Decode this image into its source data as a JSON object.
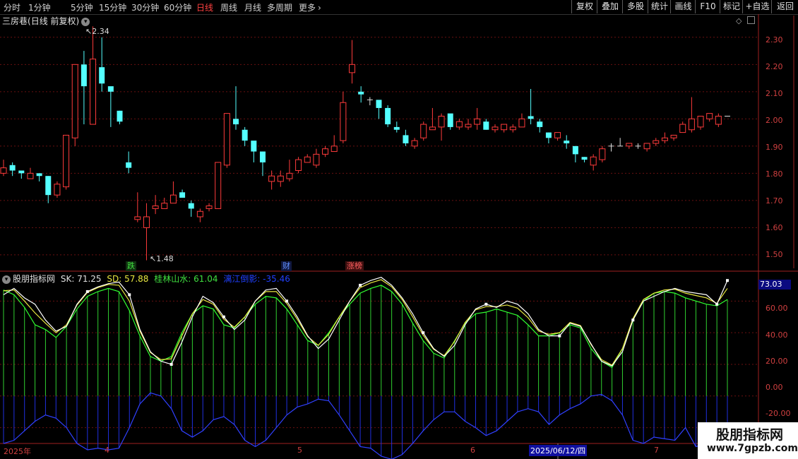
{
  "toolbar": {
    "periods": [
      "分时",
      "1分钟",
      "5分钟",
      "15分钟",
      "30分钟",
      "60分钟",
      "日线",
      "周线",
      "月线",
      "多周期",
      "更多"
    ],
    "active_period": "日线",
    "more_arrow": "›",
    "buttons": [
      "复权",
      "叠加",
      "多股",
      "统计",
      "画线",
      "F10",
      "标记",
      "+自选",
      "返回"
    ]
  },
  "main_chart": {
    "stock_name": "三房巷",
    "mode": "(日线 前复权)",
    "high_marker": "2.34",
    "low_marker": "1.48",
    "price_ticks": [
      "2.30",
      "2.20",
      "2.10",
      "2.00",
      "1.90",
      "1.80",
      "1.70",
      "1.60",
      "1.50"
    ],
    "event_tags": [
      {
        "label": "跌",
        "color": "#40c040"
      },
      {
        "label": "财",
        "color": "#4080ff"
      },
      {
        "label": "涨榜",
        "color": "#ff5050"
      }
    ],
    "up_color": "#ff3b3b",
    "down_color": "#54ffff"
  },
  "indicator": {
    "name": "股朋指标网",
    "sk_label": "SK: 71.25",
    "sd_label": "SD: 57.88",
    "gl_label": "桂林山水: 61.04",
    "lj_label": "漓江倒影: -35.46",
    "current_value": "73.03",
    "ticks": [
      "60.00",
      "40.00",
      "20.00",
      "0.00",
      "-20.00"
    ]
  },
  "date_axis": {
    "labels": [
      "2025年",
      "4",
      "5",
      "6",
      "2025/06/12/四",
      "7"
    ]
  },
  "watermark": {
    "title": "股朋指标网",
    "url": "www.7gpzb.com"
  },
  "chart_data": {
    "type": "candlestick",
    "columns": [
      "open",
      "high",
      "low",
      "close"
    ],
    "candles": [
      [
        1.8,
        1.85,
        1.79,
        1.82
      ],
      [
        1.83,
        1.84,
        1.79,
        1.81
      ],
      [
        1.81,
        1.81,
        1.78,
        1.8
      ],
      [
        1.78,
        1.82,
        1.78,
        1.8
      ],
      [
        1.8,
        1.8,
        1.77,
        1.79
      ],
      [
        1.79,
        1.79,
        1.69,
        1.72
      ],
      [
        1.72,
        1.77,
        1.71,
        1.76
      ],
      [
        1.75,
        1.94,
        1.74,
        1.94
      ],
      [
        1.93,
        2.19,
        1.9,
        2.2
      ],
      [
        2.2,
        2.25,
        1.98,
        2.12
      ],
      [
        1.98,
        2.34,
        1.98,
        2.22
      ],
      [
        2.19,
        2.3,
        2.1,
        2.13
      ],
      [
        2.12,
        2.11,
        1.97,
        2.1
      ],
      [
        2.03,
        2.03,
        1.98,
        1.99
      ],
      [
        1.84,
        1.88,
        1.8,
        1.82
      ],
      [
        1.63,
        1.73,
        1.62,
        1.64
      ],
      [
        1.6,
        1.69,
        1.48,
        1.64
      ],
      [
        1.67,
        1.72,
        1.65,
        1.68
      ],
      [
        1.67,
        1.71,
        1.67,
        1.69
      ],
      [
        1.69,
        1.77,
        1.69,
        1.72
      ],
      [
        1.73,
        1.74,
        1.71,
        1.71
      ],
      [
        1.69,
        1.7,
        1.64,
        1.67
      ],
      [
        1.64,
        1.67,
        1.62,
        1.66
      ],
      [
        1.67,
        1.69,
        1.66,
        1.68
      ],
      [
        1.67,
        1.72,
        1.67,
        1.84
      ],
      [
        1.83,
        2.02,
        1.82,
        2.02
      ],
      [
        2.0,
        2.12,
        1.96,
        1.98
      ],
      [
        1.96,
        1.97,
        1.9,
        1.92
      ],
      [
        1.92,
        1.89,
        1.84,
        1.88
      ],
      [
        1.88,
        1.88,
        1.79,
        1.84
      ],
      [
        1.77,
        1.81,
        1.74,
        1.79
      ],
      [
        1.77,
        1.81,
        1.75,
        1.79
      ],
      [
        1.78,
        1.85,
        1.77,
        1.8
      ],
      [
        1.81,
        1.86,
        1.8,
        1.85
      ],
      [
        1.84,
        1.87,
        1.84,
        1.86
      ],
      [
        1.83,
        1.89,
        1.82,
        1.87
      ],
      [
        1.87,
        1.9,
        1.86,
        1.89
      ],
      [
        1.88,
        1.94,
        1.88,
        1.9
      ],
      [
        1.92,
        2.1,
        1.91,
        2.06
      ],
      [
        2.17,
        2.29,
        2.13,
        2.2
      ],
      [
        2.1,
        2.12,
        2.06,
        2.09
      ],
      [
        2.07,
        2.08,
        2.05,
        2.07
      ],
      [
        2.07,
        2.04,
        2.0,
        2.04
      ],
      [
        2.04,
        2.05,
        1.97,
        1.98
      ],
      [
        1.97,
        1.99,
        1.95,
        1.96
      ],
      [
        1.94,
        1.96,
        1.9,
        1.91
      ],
      [
        1.9,
        1.93,
        1.89,
        1.92
      ],
      [
        1.93,
        1.99,
        1.92,
        1.98
      ],
      [
        1.96,
        2.04,
        1.96,
        1.97
      ],
      [
        1.97,
        2.02,
        1.92,
        2.01
      ],
      [
        2.02,
        2.01,
        1.96,
        1.97
      ],
      [
        1.97,
        2.0,
        1.96,
        1.99
      ],
      [
        1.97,
        2.0,
        1.96,
        1.98
      ],
      [
        1.98,
        2.04,
        1.96,
        2.0
      ],
      [
        1.99,
        2.0,
        1.96,
        1.96
      ],
      [
        1.96,
        1.98,
        1.95,
        1.97
      ],
      [
        1.96,
        1.98,
        1.95,
        1.98
      ],
      [
        1.96,
        1.98,
        1.95,
        1.97
      ],
      [
        1.97,
        2.02,
        1.97,
        2.0
      ],
      [
        2.01,
        2.11,
        1.98,
        2.0
      ],
      [
        1.99,
        2.0,
        1.95,
        1.97
      ],
      [
        1.95,
        1.95,
        1.91,
        1.93
      ],
      [
        1.93,
        1.95,
        1.92,
        1.95
      ],
      [
        1.92,
        1.94,
        1.89,
        1.91
      ],
      [
        1.9,
        1.9,
        1.84,
        1.87
      ],
      [
        1.86,
        1.86,
        1.84,
        1.85
      ],
      [
        1.83,
        1.87,
        1.81,
        1.86
      ],
      [
        1.85,
        1.9,
        1.84,
        1.89
      ],
      [
        1.9,
        1.91,
        1.88,
        1.9
      ],
      [
        1.9,
        1.93,
        1.9,
        1.9
      ],
      [
        1.9,
        1.91,
        1.89,
        1.91
      ],
      [
        1.9,
        1.91,
        1.89,
        1.9
      ],
      [
        1.89,
        1.91,
        1.88,
        1.91
      ],
      [
        1.91,
        1.93,
        1.9,
        1.92
      ],
      [
        1.92,
        1.95,
        1.91,
        1.93
      ],
      [
        1.93,
        1.94,
        1.92,
        1.94
      ],
      [
        1.95,
        1.99,
        1.95,
        1.98
      ],
      [
        1.96,
        2.08,
        1.95,
        2.0
      ],
      [
        1.97,
        2.01,
        1.96,
        2.01
      ],
      [
        2.0,
        2.02,
        1.99,
        2.02
      ],
      [
        1.98,
        2.02,
        1.97,
        2.01
      ],
      [
        2.01,
        2.01,
        2.01,
        2.01
      ]
    ],
    "indicator_series": {
      "sk": [
        64,
        68,
        62,
        58,
        48,
        41,
        44,
        58,
        66,
        69,
        71,
        72,
        64,
        42,
        28,
        22,
        20,
        34,
        50,
        63,
        59,
        50,
        42,
        48,
        60,
        67,
        68,
        60,
        50,
        38,
        30,
        36,
        48,
        60,
        70,
        73,
        75,
        70,
        62,
        52,
        40,
        30,
        25,
        32,
        45,
        55,
        58,
        56,
        60,
        58,
        52,
        42,
        38,
        38,
        46,
        44,
        33,
        22,
        19,
        28,
        48,
        60,
        63,
        66,
        68,
        66,
        65,
        64,
        58,
        73
      ],
      "sd": [
        67,
        64,
        56,
        45,
        42,
        37,
        44,
        55,
        63,
        66,
        68,
        66,
        54,
        38,
        25,
        22,
        25,
        40,
        52,
        57,
        55,
        45,
        43,
        50,
        58,
        63,
        62,
        55,
        45,
        35,
        32,
        40,
        50,
        58,
        65,
        68,
        70,
        66,
        58,
        46,
        35,
        27,
        24,
        35,
        46,
        52,
        53,
        55,
        53,
        51,
        45,
        38,
        38,
        40,
        45,
        43,
        30,
        22,
        18,
        30,
        48,
        60,
        65,
        66,
        65,
        62,
        60,
        58,
        57,
        61
      ],
      "lj": [
        -30,
        -28,
        -22,
        -16,
        -12,
        -14,
        -20,
        -30,
        -34,
        -33,
        -34,
        -33,
        -20,
        -5,
        2,
        0,
        -8,
        -22,
        -26,
        -22,
        -15,
        -13,
        -18,
        -28,
        -32,
        -28,
        -20,
        -12,
        -7,
        -5,
        -2,
        -3,
        -12,
        -22,
        -32,
        -33,
        -38,
        -40,
        -37,
        -30,
        -22,
        -15,
        -10,
        -10,
        -16,
        -20,
        -25,
        -22,
        -16,
        -10,
        -8,
        -10,
        -18,
        -12,
        -8,
        -5,
        0,
        1,
        -3,
        -12,
        -28,
        -30,
        -26,
        -27,
        -28,
        -20,
        -32,
        -30,
        -26,
        -35
      ]
    },
    "price_ylim": [
      1.44,
      2.38
    ],
    "indicator_ylim": [
      -30,
      78
    ]
  }
}
